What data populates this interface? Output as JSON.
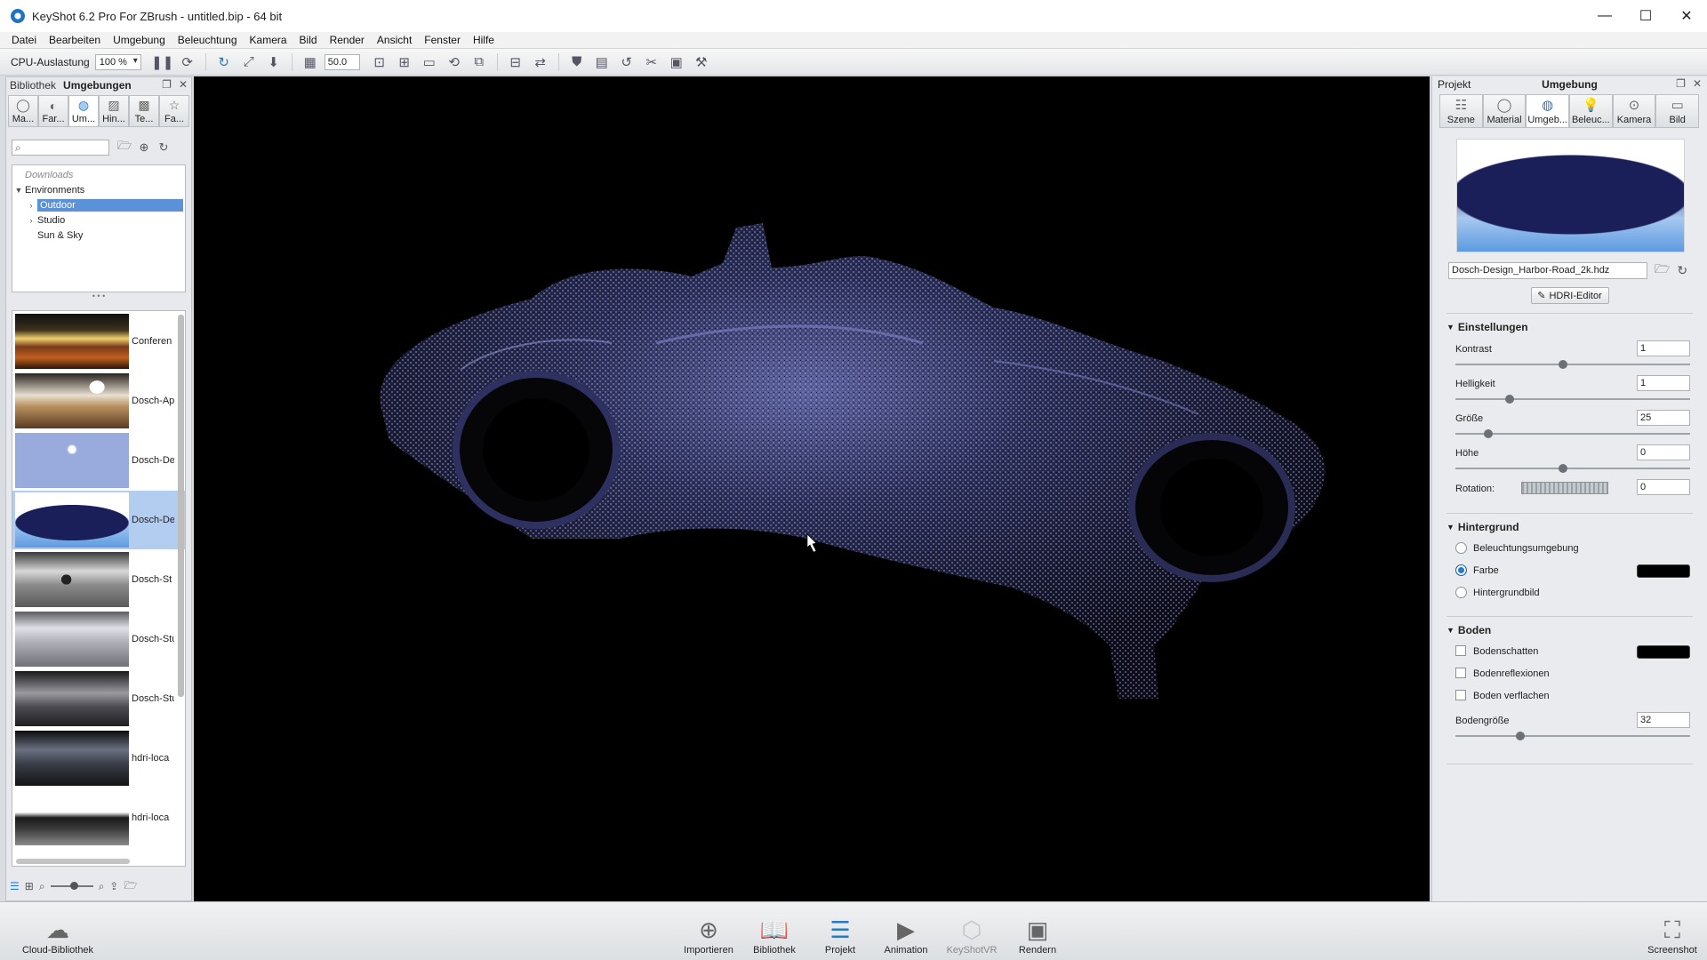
{
  "window": {
    "title": "KeyShot 6.2 Pro For ZBrush - untitled.bip - 64 bit",
    "minimize": "—",
    "maximize": "☐",
    "close": "✕"
  },
  "menu": [
    "Datei",
    "Bearbeiten",
    "Umgebung",
    "Beleuchtung",
    "Kamera",
    "Bild",
    "Render",
    "Ansicht",
    "Fenster",
    "Hilfe"
  ],
  "toolbar": {
    "cpu_label": "CPU-Auslastung",
    "cpu_value": "100 %",
    "fov_value": "50.0"
  },
  "library": {
    "title": "Bibliothek",
    "active_title": "Umgebungen",
    "tabs": [
      "Ma...",
      "Far...",
      "Um...",
      "Hin...",
      "Te...",
      "Fa..."
    ],
    "search_placeholder": "",
    "tree": {
      "downloads": "Downloads",
      "root": "Environments",
      "children": [
        "Outdoor",
        "Studio",
        "Sun & Sky"
      ]
    },
    "thumbnails": [
      "Conferen",
      "Dosch-Ap",
      "Dosch-De",
      "Dosch-De",
      "Dosch-St",
      "Dosch-Stu",
      "Dosch-Stu",
      "hdri-loca",
      "hdri-loca"
    ]
  },
  "right_panel": {
    "title_left": "Projekt",
    "title_center": "Umgebung",
    "tabs": [
      "Szene",
      "Material",
      "Umgeb...",
      "Beleuc...",
      "Kamera",
      "Bild"
    ],
    "hdri_file": "Dosch-Design_Harbor-Road_2k.hdz",
    "hdri_editor": "HDRI-Editor",
    "settings": {
      "title": "Einstellungen",
      "contrast_label": "Kontrast",
      "contrast": "1",
      "brightness_label": "Helligkeit",
      "brightness": "1",
      "size_label": "Größe",
      "size": "25",
      "height_label": "Höhe",
      "height": "0",
      "rotation_label": "Rotation:",
      "rotation": "0"
    },
    "background": {
      "title": "Hintergrund",
      "options": [
        "Beleuchtungsumgebung",
        "Farbe",
        "Hintergrundbild"
      ],
      "selected": "Farbe",
      "color": "#000000"
    },
    "ground": {
      "title": "Boden",
      "shadow": "Bodenschatten",
      "reflections": "Bodenreflexionen",
      "flatten": "Boden verflachen",
      "size_label": "Bodengröße",
      "size": "32",
      "shadow_color": "#000000"
    }
  },
  "bottom": {
    "cloud": "Cloud-Bibliothek",
    "buttons": [
      "Importieren",
      "Bibliothek",
      "Projekt",
      "Animation",
      "KeyShotVR",
      "Rendern"
    ],
    "screenshot": "Screenshot"
  },
  "colors": {
    "accent": "#2b78c8",
    "selection": "#5b91d8"
  }
}
